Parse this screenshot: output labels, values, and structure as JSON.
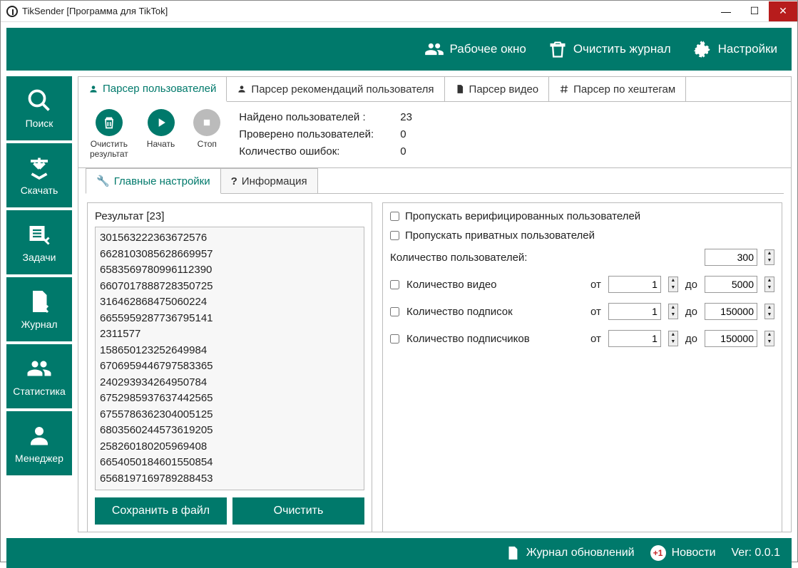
{
  "window": {
    "title": "TikSender [Программа для TikTok]"
  },
  "toolbar": {
    "workspace": "Рабочее окно",
    "clear_log": "Очистить журнал",
    "settings": "Настройки"
  },
  "sidebar": {
    "search": "Поиск",
    "download": "Скачать",
    "tasks": "Задачи",
    "journal": "Журнал",
    "stats": "Статистика",
    "manager": "Менеджер"
  },
  "tabs": {
    "parser_users": "Парсер пользователей",
    "parser_recs": "Парсер рекомендаций пользователя",
    "parser_video": "Парсер видео",
    "parser_hash": "Парсер по хештегам"
  },
  "actions": {
    "clear_result": "Очистить\nрезультат",
    "start": "Начать",
    "stop": "Стоп"
  },
  "stats": {
    "found_label": "Найдено пользователей :",
    "found_value": "23",
    "checked_label": "Проверено пользователей:",
    "checked_value": "0",
    "errors_label": "Количество ошибок:",
    "errors_value": "0"
  },
  "sub_tabs": {
    "main_settings": "Главные настройки",
    "info": "Информация"
  },
  "result": {
    "label": "Результат [23]",
    "items": [
      "301563222363672576",
      "6628103085628669957",
      "6583569780996112390",
      "6607017888728350725",
      "316462868475060224",
      "6655959287736795141",
      "2311577",
      "158650123252649984",
      "6706959446797583365",
      "240293934264950784",
      "6752985937637442565",
      "6755786362304005125",
      "6803560244573619205",
      "258260180205969408",
      "6654050184601550854",
      "6568197169789288453"
    ],
    "save": "Сохранить в файл",
    "clear": "Очистить"
  },
  "filters": {
    "skip_verified": "Пропускать верифицированных пользователей",
    "skip_private": "Пропускать приватных пользователей",
    "user_count_label": "Количество пользователей:",
    "user_count": "300",
    "video_count_label": "Количество видео",
    "video_from": "1",
    "video_to": "5000",
    "subs_label": "Количество подписок",
    "subs_from": "1",
    "subs_to": "150000",
    "followers_label": "Количество подписчиков",
    "followers_from": "1",
    "followers_to": "150000",
    "from": "от",
    "to": "до"
  },
  "footer": {
    "changelog": "Журнал обновлений",
    "news_badge": "+1",
    "news": "Новости",
    "version": "Ver: 0.0.1"
  }
}
